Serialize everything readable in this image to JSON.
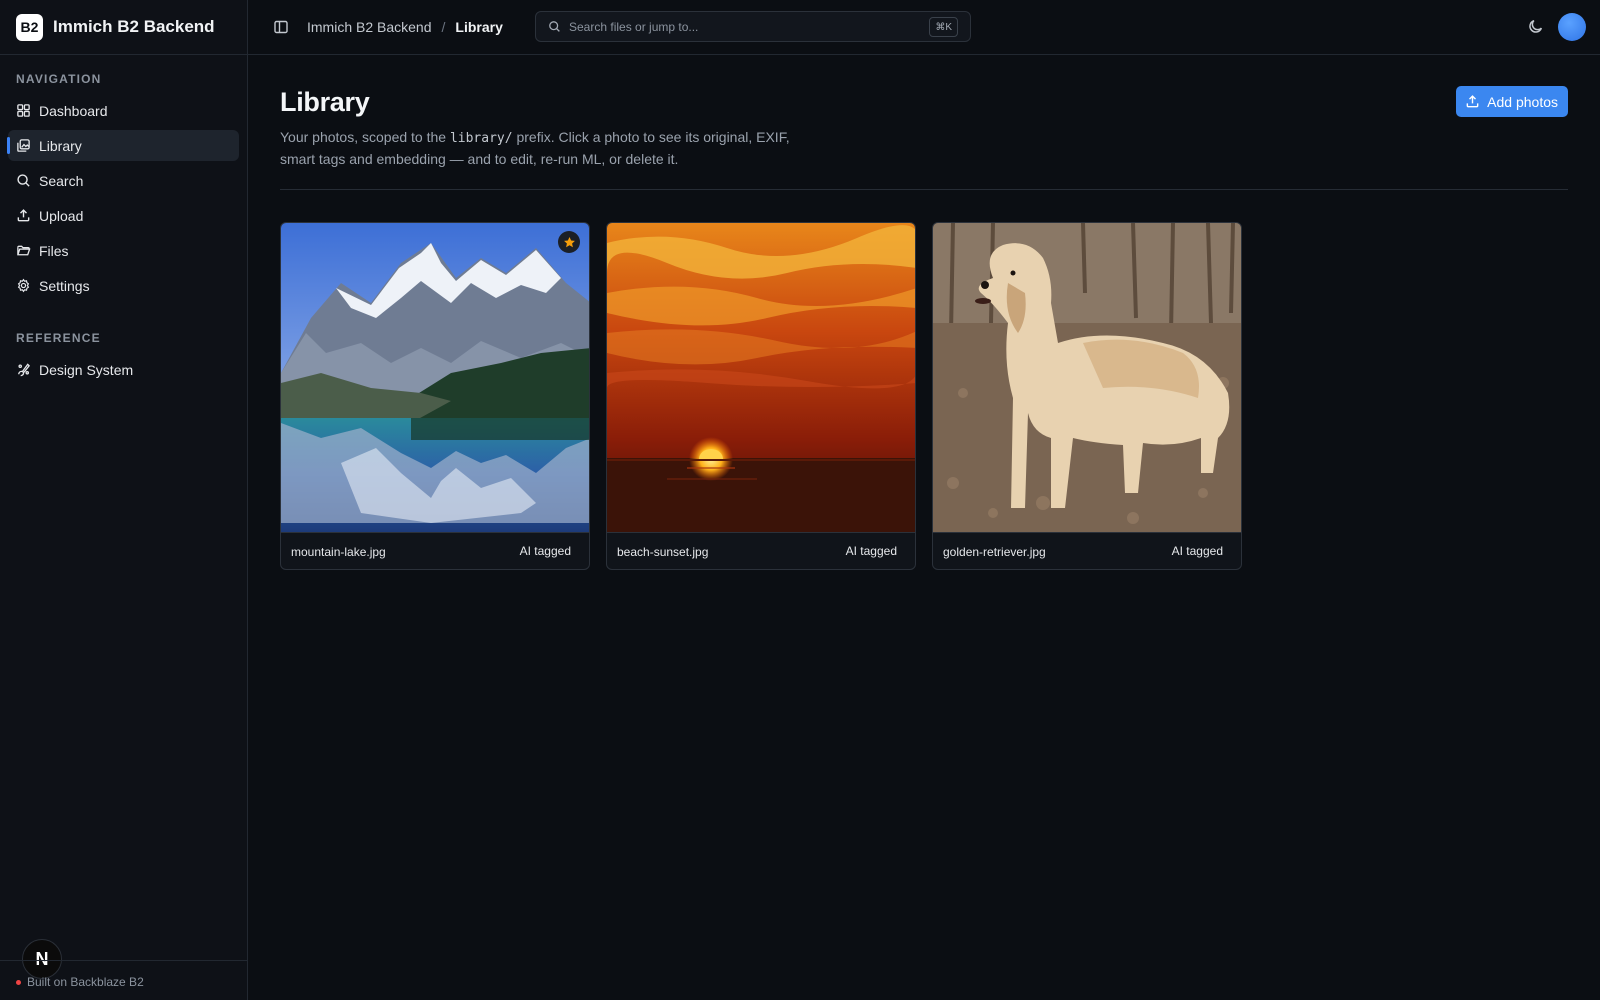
{
  "app": {
    "logo_text": "B2",
    "name": "Immich B2 Backend"
  },
  "sidebar": {
    "nav_heading": "NAVIGATION",
    "items": [
      {
        "label": "Dashboard",
        "icon": "dashboard-icon",
        "active": false
      },
      {
        "label": "Library",
        "icon": "library-icon",
        "active": true
      },
      {
        "label": "Search",
        "icon": "search-icon",
        "active": false
      },
      {
        "label": "Upload",
        "icon": "upload-icon",
        "active": false
      },
      {
        "label": "Files",
        "icon": "folder-icon",
        "active": false
      },
      {
        "label": "Settings",
        "icon": "gear-icon",
        "active": false
      }
    ],
    "reference_heading": "REFERENCE",
    "reference_items": [
      {
        "label": "Design System",
        "icon": "design-icon"
      }
    ],
    "footer_text": "Built on Backblaze B2",
    "badge_letter": "N"
  },
  "topbar": {
    "breadcrumb_parent": "Immich B2 Backend",
    "breadcrumb_separator": "/",
    "breadcrumb_current": "Library",
    "search_placeholder": "Search files or jump to...",
    "search_shortcut": "⌘K"
  },
  "page": {
    "title": "Library",
    "desc_before": "Your photos, scoped to the ",
    "desc_code": "library/",
    "desc_after": " prefix. Click a photo to see its original, EXIF, smart tags and embedding — and to edit, re-run ML, or delete it.",
    "add_button": "Add photos"
  },
  "photos": [
    {
      "filename": "mountain-lake.jpg",
      "tag": "AI tagged",
      "starred": true
    },
    {
      "filename": "beach-sunset.jpg",
      "tag": "AI tagged",
      "starred": false
    },
    {
      "filename": "golden-retriever.jpg",
      "tag": "AI tagged",
      "starred": false
    }
  ],
  "colors": {
    "accent": "#3b87f0",
    "background": "#0b0e13",
    "star": "#f59e0b"
  }
}
